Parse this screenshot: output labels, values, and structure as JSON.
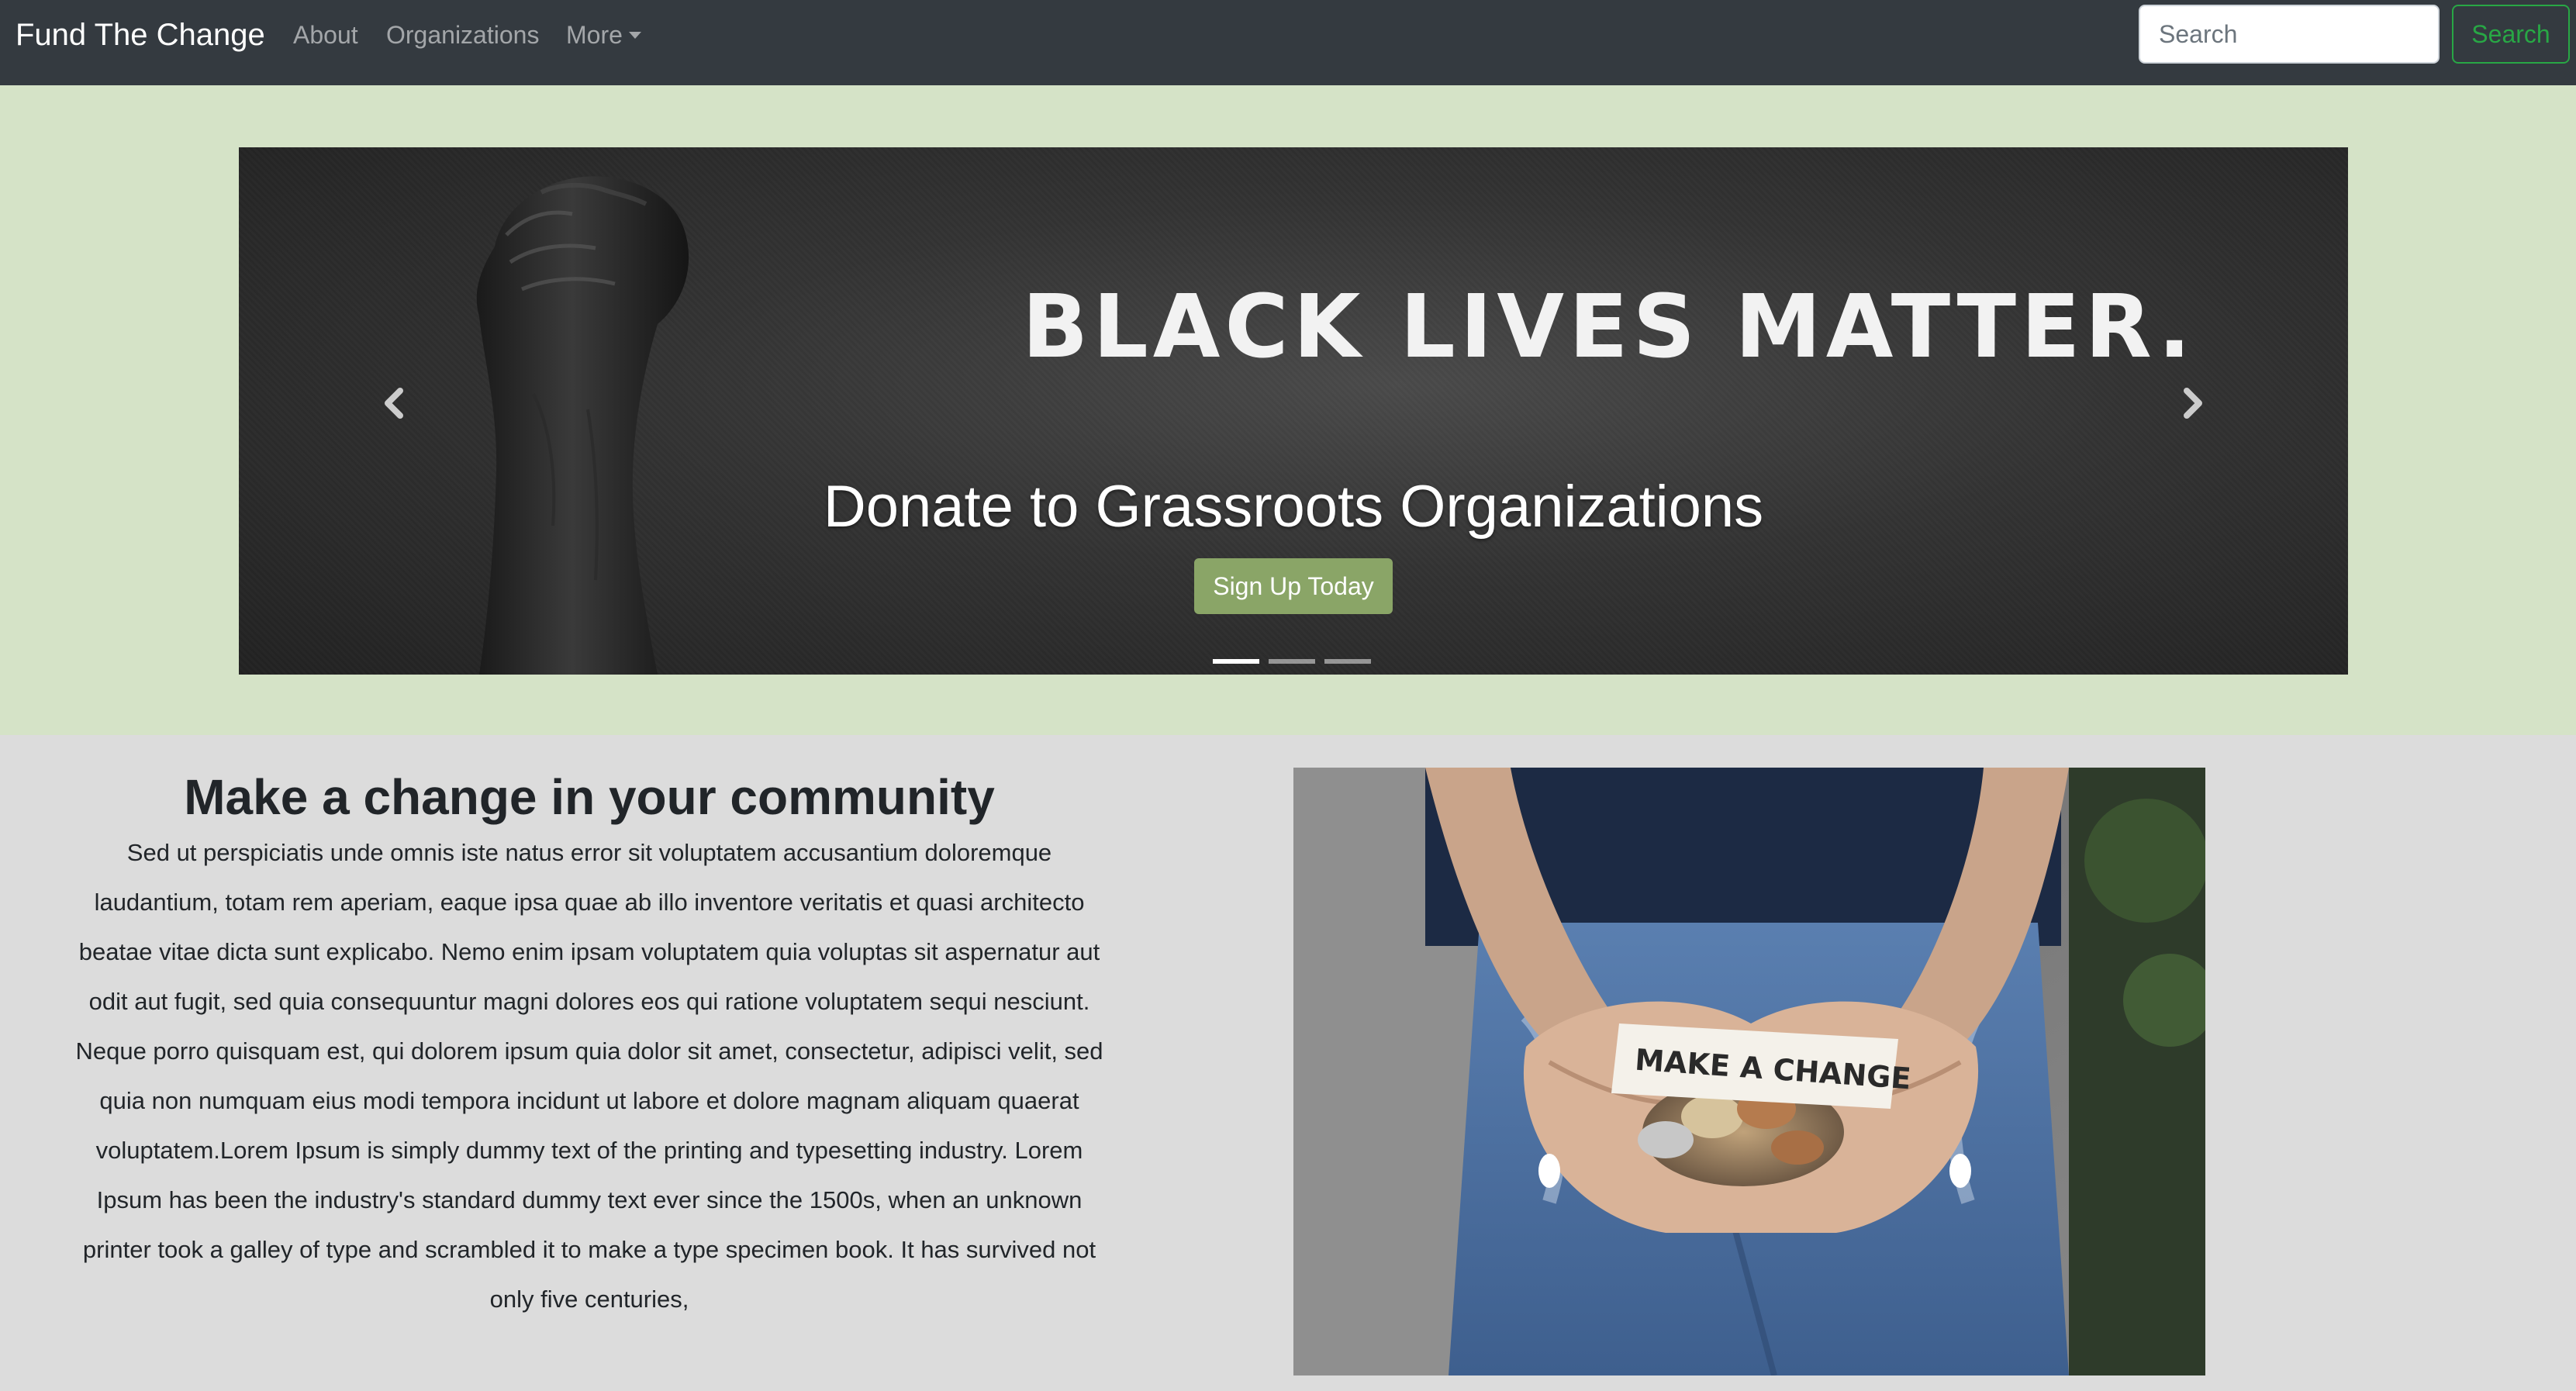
{
  "navbar": {
    "brand": "Fund The Change",
    "links": [
      "About",
      "Organizations"
    ],
    "more_label": "More",
    "search_placeholder": "Search",
    "search_button": "Search"
  },
  "carousel": {
    "slide_text": "BLACK LIVES MATTER.",
    "caption": "Donate to Grassroots Organizations",
    "button": "Sign Up Today",
    "slide_count": 3,
    "active_slide": 1
  },
  "section": {
    "heading": "Make a change in your community",
    "body": "Sed ut perspiciatis unde omnis iste natus error sit voluptatem accusantium doloremque laudantium, totam rem aperiam, eaque ipsa quae ab illo inventore veritatis et quasi architecto beatae vitae dicta sunt explicabo. Nemo enim ipsam voluptatem quia voluptas sit aspernatur aut odit aut fugit, sed quia consequuntur magni dolores eos qui ratione voluptatem sequi nesciunt. Neque porro quisquam est, qui dolorem ipsum quia dolor sit amet, consectetur, adipisci velit, sed quia non numquam eius modi tempora incidunt ut labore et dolore magnam aliquam quaerat voluptatem.Lorem Ipsum is simply dummy text of the printing and typesetting industry. Lorem Ipsum has been the industry's standard dummy text ever since the 1500s, when an unknown printer took a galley of type and scrambled it to make a type specimen book. It has survived not only five centuries,",
    "photo_text": "MAKE A CHANGE"
  },
  "colors": {
    "navbar_bg": "#343a40",
    "hero_bg": "#d5e3c7",
    "page_bg": "#dcdcdc",
    "accent_green": "#8aa567",
    "search_green": "#28a745"
  },
  "icons": {
    "prev": "chevron-left-icon",
    "next": "chevron-right-icon",
    "dropdown": "caret-down-icon"
  }
}
